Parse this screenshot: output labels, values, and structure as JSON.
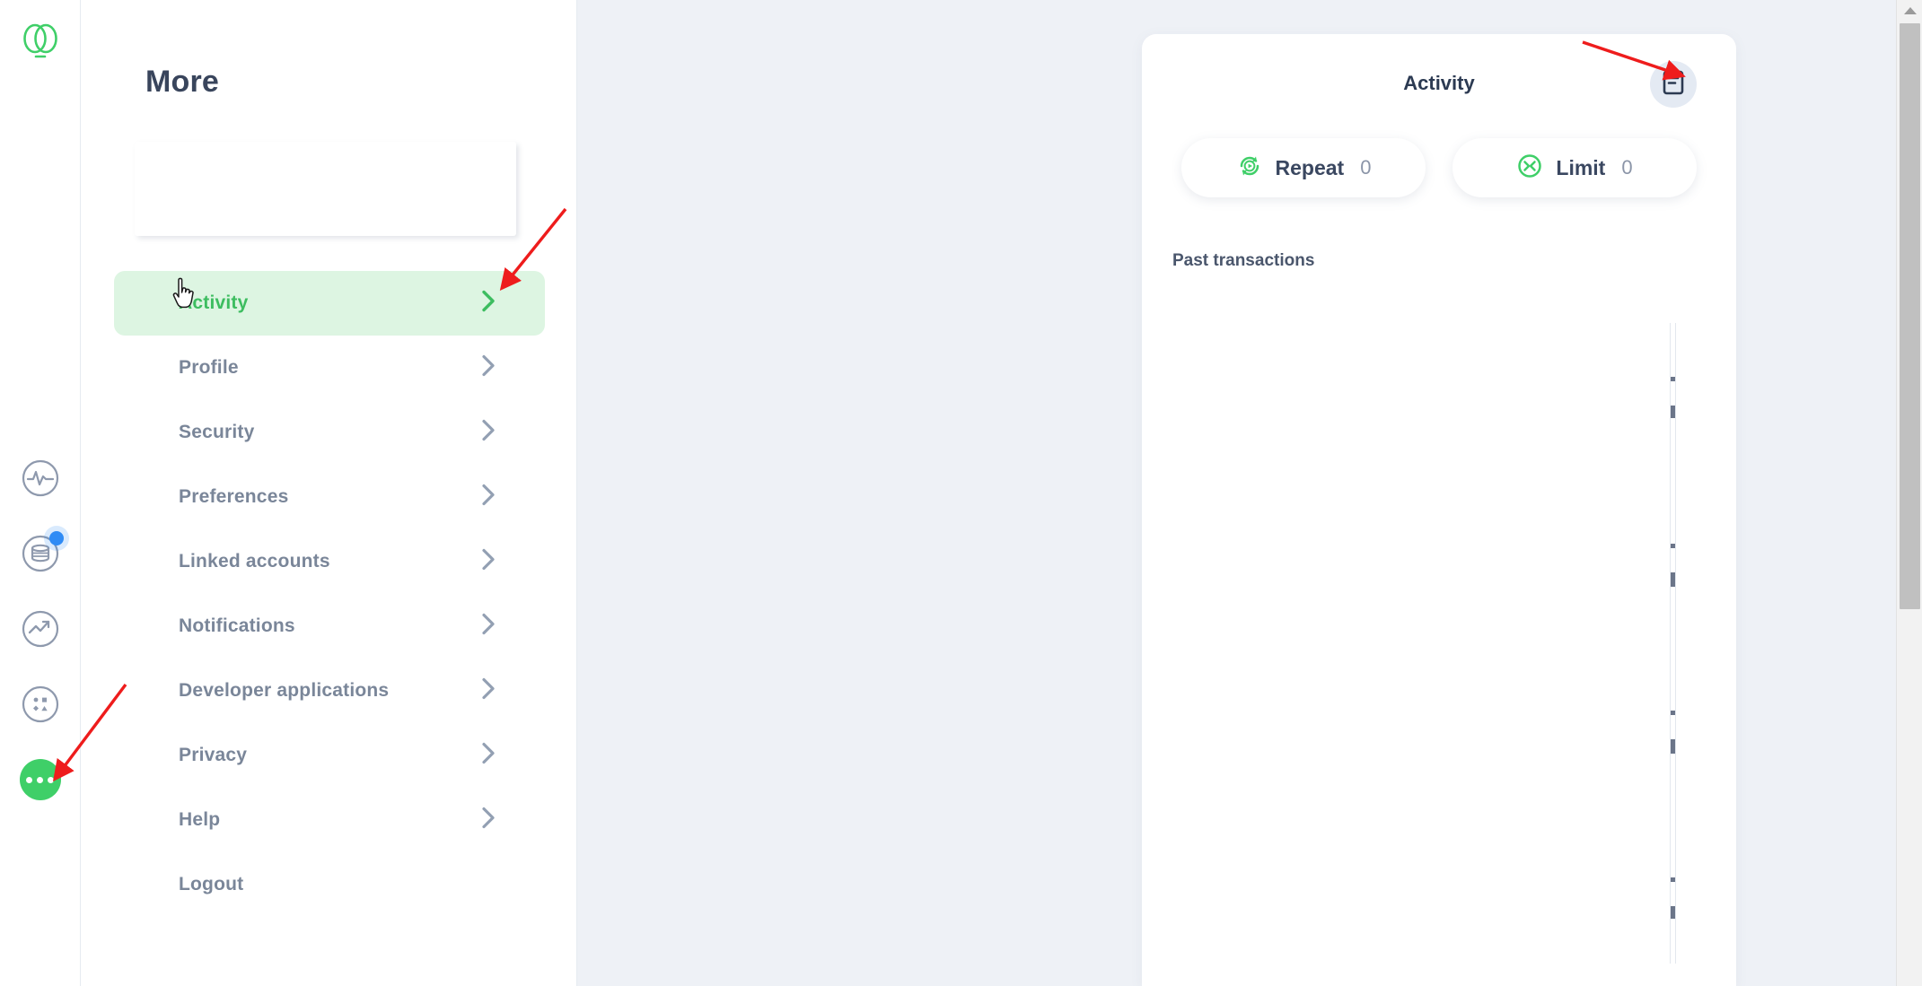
{
  "app": {
    "brand_color": "#3fcf68",
    "background": "#eef1f6",
    "logo_name": "app-logo"
  },
  "rail": {
    "items": [
      {
        "name": "pulse-icon",
        "label": "Pulse",
        "badge": false
      },
      {
        "name": "accounts-icon",
        "label": "Accounts",
        "badge": true,
        "badge_color": "#2f8bf5"
      },
      {
        "name": "trending-up-icon",
        "label": "Invest",
        "badge": false
      },
      {
        "name": "shapes-icon",
        "label": "Products",
        "badge": false
      }
    ],
    "more_button": {
      "name": "more-button",
      "label": "More",
      "color": "#3fcf68"
    }
  },
  "more_panel": {
    "title": "More",
    "menu": [
      {
        "label": "Activity",
        "active": true,
        "chevron": true
      },
      {
        "label": "Profile",
        "active": false,
        "chevron": true
      },
      {
        "label": "Security",
        "active": false,
        "chevron": true
      },
      {
        "label": "Preferences",
        "active": false,
        "chevron": true
      },
      {
        "label": "Linked accounts",
        "active": false,
        "chevron": true
      },
      {
        "label": "Notifications",
        "active": false,
        "chevron": true
      },
      {
        "label": "Developer applications",
        "active": false,
        "chevron": true
      },
      {
        "label": "Privacy",
        "active": false,
        "chevron": true
      },
      {
        "label": "Help",
        "active": false,
        "chevron": true
      },
      {
        "label": "Logout",
        "active": false,
        "chevron": false
      }
    ],
    "active_color": "#3dbd60",
    "active_bg": "#ddf5e2"
  },
  "activity_panel": {
    "title": "Activity",
    "statement_button": {
      "name": "statement-icon",
      "label": "Statement"
    },
    "pills": [
      {
        "label": "Repeat",
        "count": "0",
        "icon": "repeat-icon"
      },
      {
        "label": "Limit",
        "count": "0",
        "icon": "limit-icon"
      }
    ],
    "section_title": "Past transactions"
  },
  "scrollbar": {
    "name": "page-scrollbar",
    "position": "right"
  },
  "annotations": {
    "arrow_color": "#ee1c1c",
    "arrows": [
      {
        "name": "arrow-to-activity-item",
        "target": "Activity"
      },
      {
        "name": "arrow-to-more-button",
        "target": "More"
      },
      {
        "name": "arrow-to-statement-button",
        "target": "Statement"
      }
    ],
    "cursor": {
      "name": "mouse-cursor",
      "type": "pointer-hand"
    }
  }
}
